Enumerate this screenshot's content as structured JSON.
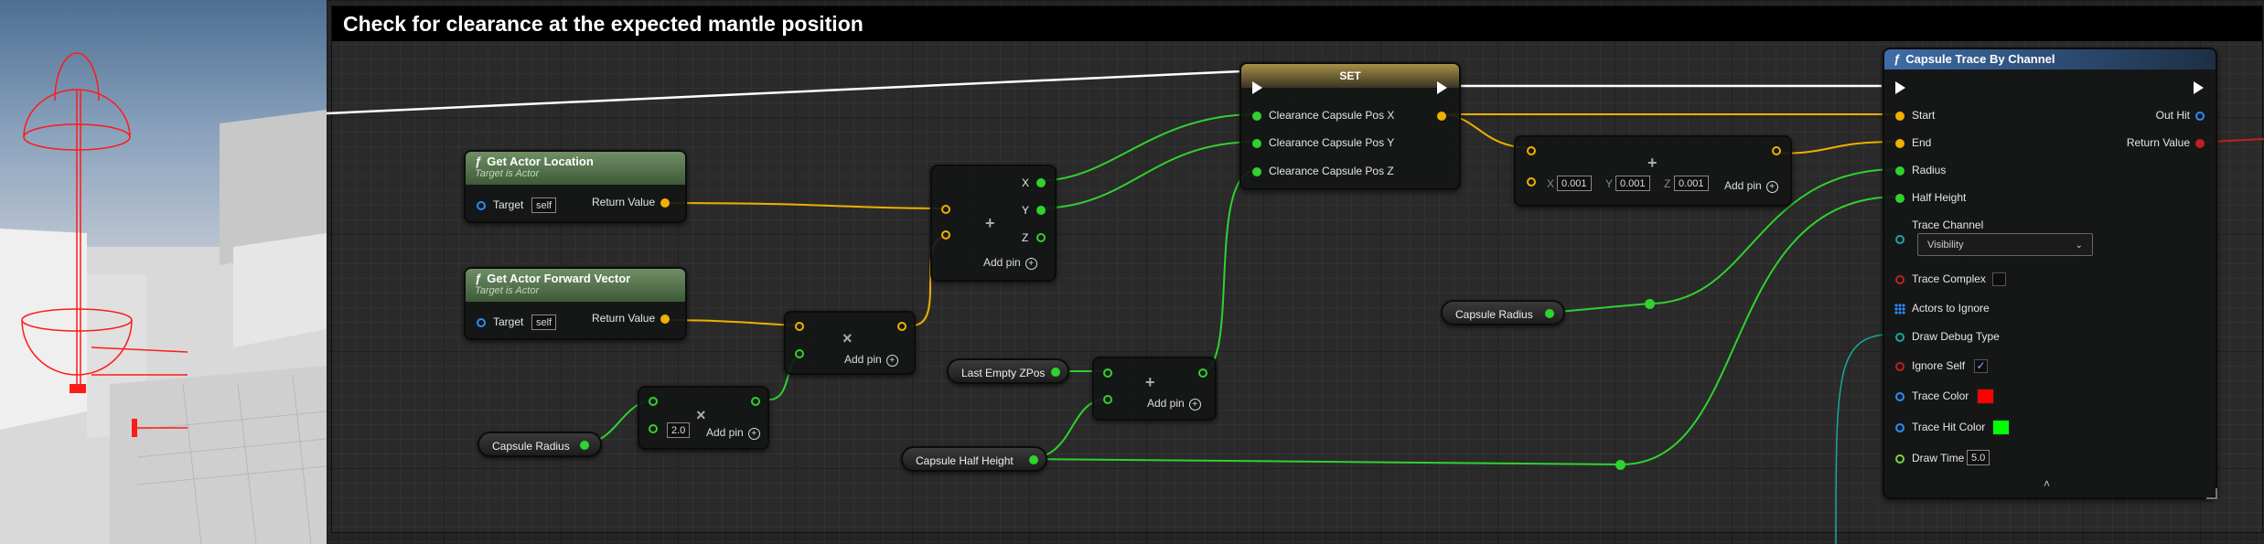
{
  "comment": {
    "title": "Check for clearance at the expected mantle position"
  },
  "nodes": {
    "get_actor_location": {
      "title": "Get Actor Location",
      "subtitle": "Target is Actor",
      "target_label": "Target",
      "target_value": "self",
      "return_label": "Return Value"
    },
    "get_actor_forward_vector": {
      "title": "Get Actor Forward Vector",
      "subtitle": "Target is Actor",
      "target_label": "Target",
      "target_value": "self",
      "return_label": "Return Value"
    },
    "multiply_float": {
      "symbol": "×",
      "value": "2.0",
      "add_pin": "Add pin"
    },
    "multiply_vector": {
      "symbol": "×",
      "add_pin": "Add pin"
    },
    "add_vector": {
      "symbol": "+",
      "add_pin": "Add pin"
    },
    "make_vector": {
      "symbol": "+",
      "pin_x": "X",
      "pin_y": "Y",
      "pin_z": "Z",
      "add_pin": "Add pin"
    },
    "add_floats": {
      "symbol": "+",
      "add_pin": "Add pin"
    },
    "set_node": {
      "title": "SET",
      "pin1": "Clearance Capsule Pos X",
      "pin2": "Clearance Capsule Pos Y",
      "pin3": "Clearance Capsule Pos Z"
    },
    "add_vector_offset": {
      "symbol": "+",
      "x_label": "X",
      "x_value": "0.001",
      "y_label": "Y",
      "y_value": "0.001",
      "z_label": "Z",
      "z_value": "0.001",
      "add_pin": "Add pin"
    },
    "capsule_trace": {
      "title": "Capsule Trace By Channel",
      "start": "Start",
      "end": "End",
      "radius": "Radius",
      "half_height": "Half Height",
      "trace_channel": "Trace Channel",
      "trace_channel_value": "Visibility",
      "trace_complex": "Trace Complex",
      "actors_to_ignore": "Actors to Ignore",
      "draw_debug_type": "Draw Debug Type",
      "ignore_self": "Ignore Self",
      "trace_color": "Trace Color",
      "trace_hit_color": "Trace Hit Color",
      "draw_time": "Draw Time",
      "draw_time_value": "5.0",
      "out_hit": "Out Hit",
      "return_value": "Return Value"
    }
  },
  "variables": {
    "capsule_radius_1": "Capsule Radius",
    "last_empty_zpos": "Last Empty ZPos",
    "capsule_half_height": "Capsule Half Height",
    "capsule_radius_2": "Capsule Radius"
  },
  "colors": {
    "float_pin": "#2fd22f",
    "vector_pin": "#f0b000",
    "exec_wire": "#ffffff",
    "trace_color": "#ff0000",
    "trace_hit_color": "#00ff00",
    "object_pin": "#2a8cff",
    "bool_pin": "#c02020"
  },
  "icons": [
    "function-icon",
    "add-pin-icon",
    "dropdown-chevron-icon",
    "checkmark-icon",
    "collapse-arrow-icon",
    "array-icon"
  ]
}
